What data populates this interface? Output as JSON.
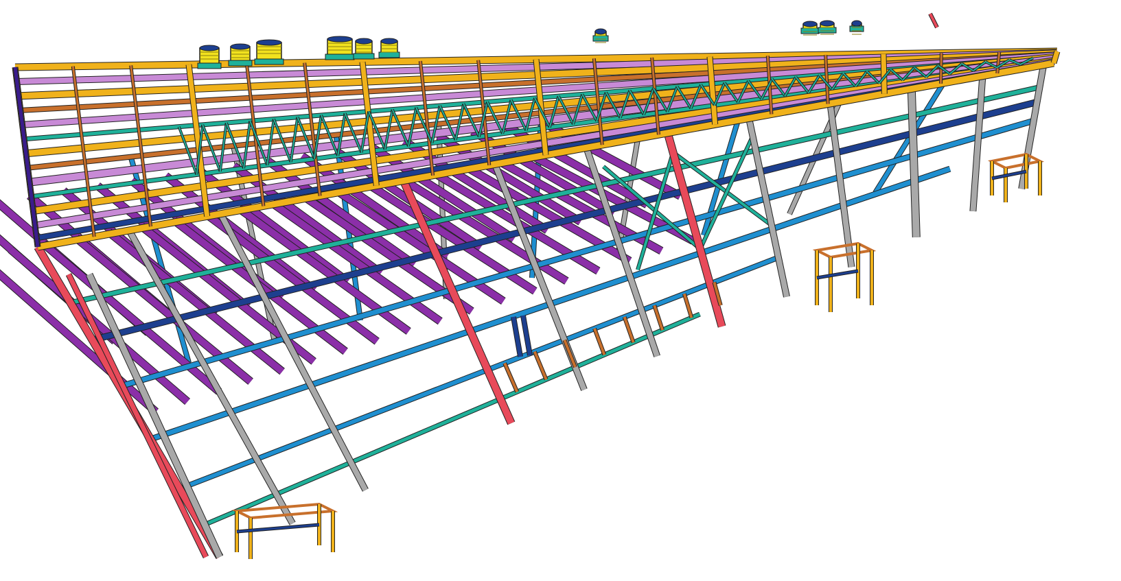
{
  "viewport": {
    "background": "#ffffff",
    "model": "steel-structure-3d-view"
  },
  "palette": {
    "roof_beam": "#f0b21b",
    "roof_beam_dark": "#b07d0c",
    "lavender_beam": "#c88ad6",
    "purple_beam": "#8b2fa8",
    "blue_beam": "#1f8fd0",
    "navy_beam": "#1d3f8f",
    "teal_beam": "#1fb19a",
    "orange_beam": "#c8702c",
    "red_column": "#e84a5a",
    "grey_column": "#a9a9a9",
    "green_plate": "#6ab04c",
    "magenta_accent": "#d0307e",
    "indigo": "#3a1c8c"
  },
  "elements": {
    "roof_equipment": "hvac-unit-icon",
    "side_platform": "platform-icon",
    "stair_tower": "stair-icon"
  }
}
